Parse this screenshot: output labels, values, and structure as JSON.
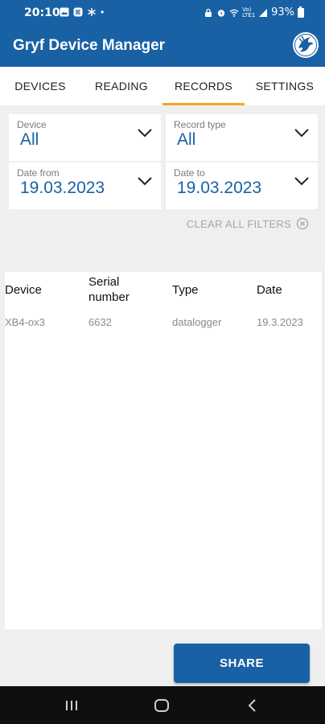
{
  "status": {
    "time": "20:10",
    "dot": "•",
    "battery": "93%",
    "network": "Vo) LTE1"
  },
  "app": {
    "title": "Gryf Device Manager",
    "logo_icon": "gryf-logo"
  },
  "tabs": [
    {
      "label": "DEVICES",
      "active": false
    },
    {
      "label": "READING",
      "active": false
    },
    {
      "label": "RECORDS",
      "active": true
    },
    {
      "label": "SETTINGS",
      "active": false
    }
  ],
  "filters": {
    "device": {
      "label": "Device",
      "value": "All"
    },
    "record_type": {
      "label": "Record type",
      "value": "All"
    },
    "date_from": {
      "label": "Date from",
      "value": "19.03.2023"
    },
    "date_to": {
      "label": "Date to",
      "value": "19.03.2023"
    },
    "clear_label": "CLEAR ALL FILTERS"
  },
  "table": {
    "headers": [
      "Device",
      "Serial\nnumber",
      "Type",
      "Date"
    ],
    "header_serial_line1": "Serial",
    "header_serial_line2": "number",
    "rows": [
      {
        "device": "XB4-ox3",
        "serial": "6632",
        "type": "datalogger",
        "date": "19.3.2023"
      }
    ]
  },
  "actions": {
    "share_label": "SHARE"
  },
  "colors": {
    "primary": "#1961a5",
    "accent": "#f5a623"
  }
}
